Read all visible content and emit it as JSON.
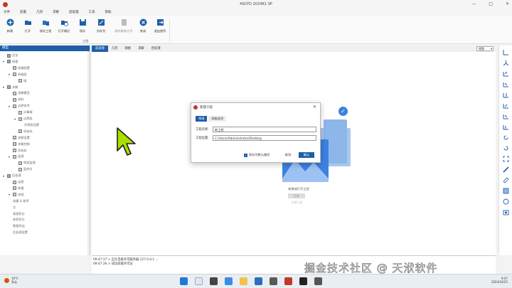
{
  "window": {
    "title": "ASCFD 2024R1 SP"
  },
  "menu": [
    "文件",
    "前置",
    "几何",
    "求解",
    "后处理",
    "工具",
    "帮助"
  ],
  "ribbon": {
    "buttons": [
      {
        "label": "新建",
        "icon": "new-icon"
      },
      {
        "label": "打开",
        "icon": "open-icon"
      },
      {
        "label": "保存工程",
        "icon": "save-icon"
      },
      {
        "label": "打开最近",
        "icon": "recent-icon"
      },
      {
        "label": "保存",
        "icon": "save-as-icon"
      },
      {
        "label": "另存为",
        "icon": "save-as-icon"
      },
      {
        "label": "删除最新文件",
        "icon": "delete-icon"
      },
      {
        "label": "关闭",
        "icon": "close-icon"
      },
      {
        "label": "退出程序",
        "icon": "exit-icon"
      }
    ],
    "group_label": "工程"
  },
  "left_panel": {
    "header": "模型",
    "tree": [
      {
        "label": "总览",
        "indent": 0,
        "tri": "",
        "box": true
      },
      {
        "label": "网格",
        "indent": 0,
        "tri": "▾",
        "box": true
      },
      {
        "label": "网格配置",
        "indent": 1,
        "tri": "",
        "box": true
      },
      {
        "label": "网格组",
        "indent": 1,
        "tri": "▾",
        "box": true
      },
      {
        "label": "域",
        "indent": 2,
        "tri": "",
        "box": true
      },
      {
        "label": "求解",
        "indent": 0,
        "tri": "▾",
        "box": true
      },
      {
        "label": "求解模型",
        "indent": 1,
        "tri": "",
        "box": true
      },
      {
        "label": "材料",
        "indent": 1,
        "tri": "",
        "box": true
      },
      {
        "label": "边界条件",
        "indent": 1,
        "tri": "▾",
        "box": true
      },
      {
        "label": "计算域",
        "indent": 2,
        "tri": "",
        "box": true
      },
      {
        "label": "边界面",
        "indent": 2,
        "tri": "▾",
        "box": true
      },
      {
        "label": "交界面设置",
        "indent": 3,
        "tri": "",
        "box": false
      },
      {
        "label": "初始化",
        "indent": 2,
        "tri": "",
        "box": true
      },
      {
        "label": "求解设置",
        "indent": 1,
        "tri": "",
        "box": true
      },
      {
        "label": "求解控制",
        "indent": 1,
        "tri": "",
        "box": true
      },
      {
        "label": "初始化",
        "indent": 1,
        "tri": "",
        "box": true
      },
      {
        "label": "监视",
        "indent": 1,
        "tri": "▾",
        "box": true
      },
      {
        "label": "残差监视",
        "indent": 2,
        "tri": "",
        "box": true
      },
      {
        "label": "监控点",
        "indent": 2,
        "tri": "",
        "box": true
      },
      {
        "label": "后处理",
        "indent": 0,
        "tri": "▾",
        "box": true
      },
      {
        "label": "云图",
        "indent": 1,
        "tri": "",
        "box": true
      },
      {
        "label": "矢量",
        "indent": 1,
        "tri": "",
        "box": true
      },
      {
        "label": "流线",
        "indent": 1,
        "tri": "▾",
        "box": true
      },
      {
        "label": "流量 & 效率",
        "indent": 1,
        "tri": "",
        "box": false
      },
      {
        "label": "力",
        "indent": 1,
        "tri": "",
        "box": false
      },
      {
        "label": "表面积分",
        "indent": 1,
        "tri": "",
        "box": false
      },
      {
        "label": "体积积分",
        "indent": 1,
        "tri": "",
        "box": false
      },
      {
        "label": "数据导出",
        "indent": 1,
        "tri": "",
        "box": false
      },
      {
        "label": "后处理设置",
        "indent": 1,
        "tri": "",
        "box": false
      }
    ]
  },
  "main_tabs": [
    "前处理",
    "几何",
    "网格",
    "求解",
    "后处理"
  ],
  "view_dropdown": "视图",
  "empty_state": {
    "text": "新建或打开工程",
    "button": "打开",
    "sub": "近期工程"
  },
  "log": [
    "09:47:17 > 正在连接许可服务器 127.0.0.1 ...",
    "09:47:26 > 成功获取许可证"
  ],
  "dialog": {
    "title": "新建工程",
    "tabs": [
      "常规",
      "高级选项"
    ],
    "name_label": "工程名称:",
    "name_value": "新工程",
    "path_label": "工程位置:",
    "path_value": "C:/Users/Administrator/Desktop",
    "default_path_label": "保存为默认路径",
    "cancel_label": "取消",
    "ok_label": "确认"
  },
  "watermark": "掘金技术社区 @ 天洑软件",
  "taskbar": {
    "weather_temp": "19°C",
    "weather_desc": "多云",
    "time": "9:47",
    "date": "2024/10/25"
  },
  "colors": {
    "accent": "#1e5fa8",
    "illustration": "#3b82e0",
    "cursor": "#a8e000"
  }
}
